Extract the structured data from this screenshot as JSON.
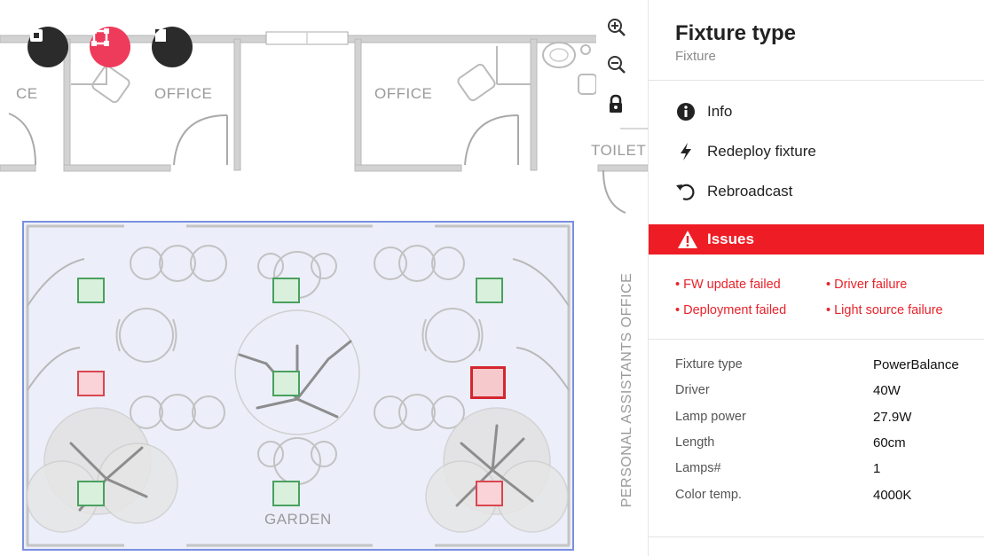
{
  "map": {
    "labels": {
      "office_left_partial": "CE",
      "office_1": "OFFICE",
      "office_2": "OFFICE",
      "toilet_partial": "TOILET",
      "garden": "GARDEN",
      "personal_assistants_office": "PERSONAL ASSISTANTS OFFICE"
    },
    "tools": [
      {
        "name": "single-select",
        "icon": "square-select-icon",
        "active": false
      },
      {
        "name": "area-select",
        "icon": "area-select-icon",
        "active": true
      },
      {
        "name": "layers",
        "icon": "layer-icon",
        "active": false
      }
    ],
    "zoom": [
      "zoom-in-icon",
      "zoom-out-icon",
      "lock-icon"
    ],
    "fixtures": [
      {
        "status": "ok"
      },
      {
        "status": "ok"
      },
      {
        "status": "ok"
      },
      {
        "status": "issue"
      },
      {
        "status": "ok"
      },
      {
        "status": "issue",
        "selected": true
      },
      {
        "status": "ok"
      },
      {
        "status": "ok"
      },
      {
        "status": "issue"
      }
    ],
    "colors": {
      "ok": "#4aa05e",
      "issue": "#d9464f",
      "selection": "#7b8fe0"
    }
  },
  "panel": {
    "title": "Fixture type",
    "subtitle": "Fixture",
    "actions": [
      {
        "icon": "info-icon",
        "label": "Info"
      },
      {
        "icon": "bolt-icon",
        "label": "Redeploy fixture"
      },
      {
        "icon": "rebroadcast-icon",
        "label": "Rebroadcast"
      }
    ],
    "issues": {
      "title": "Issues",
      "icon": "warning-icon",
      "items": [
        "• FW update failed",
        "• Driver failure",
        "• Deployment failed",
        "• Light source failure"
      ]
    },
    "properties": [
      {
        "key": "Fixture type",
        "value": "PowerBalance"
      },
      {
        "key": "Driver",
        "value": "40W"
      },
      {
        "key": "Lamp power",
        "value": "27.9W"
      },
      {
        "key": "Length",
        "value": "60cm"
      },
      {
        "key": "Lamps#",
        "value": "1"
      },
      {
        "key": "Color temp.",
        "value": "4000K"
      }
    ],
    "accent": "#ee1c24"
  }
}
